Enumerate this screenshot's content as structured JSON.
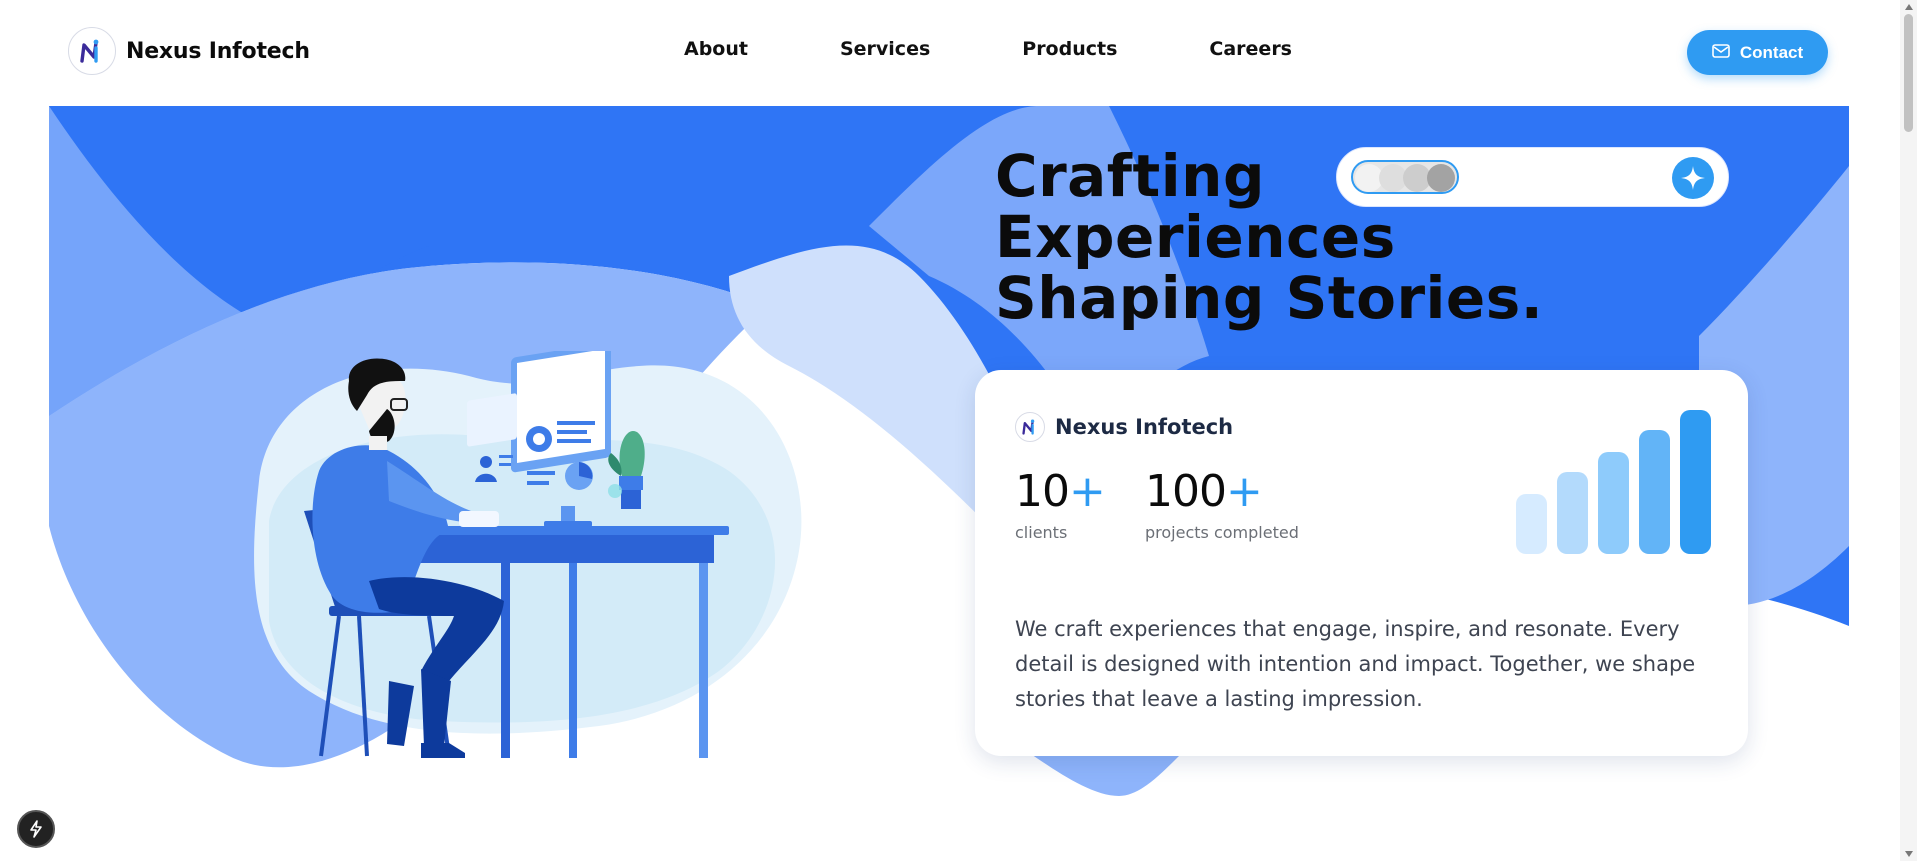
{
  "brand": {
    "name": "Nexus Infotech",
    "logo_icon": "nexus-logo-icon"
  },
  "nav": {
    "links": [
      {
        "label": "About"
      },
      {
        "label": "Services"
      },
      {
        "label": "Products"
      },
      {
        "label": "Careers"
      }
    ],
    "contact": {
      "label": "Contact",
      "icon": "mail-icon"
    }
  },
  "hero": {
    "headline": [
      "Crafting",
      "Experiences",
      "Shaping Stories."
    ],
    "search_pill": {
      "toggle_icon": "toggle-dots-icon",
      "action_icon": "sparkle-icon"
    },
    "illustration": "person-at-desk-illustration"
  },
  "card": {
    "brand_name": "Nexus Infotech",
    "stats": [
      {
        "number": "10",
        "suffix": "+",
        "label": "clients"
      },
      {
        "number": "100",
        "suffix": "+",
        "label": "projects completed"
      }
    ],
    "bar_levels": [
      0.42,
      0.57,
      0.71,
      0.86,
      1.0
    ],
    "bar_colors": [
      "#d6ebff",
      "#b3dafc",
      "#8ecbfb",
      "#62b4f7",
      "#2f9bf2"
    ],
    "description": "We craft experiences that engage, inspire, and resonate. Every detail is designed with intention and impact. Together, we shape stories that leave a lasting impression."
  },
  "floating_button": {
    "icon": "bolt-icon"
  },
  "colors": {
    "accent": "#2f9bf2",
    "hero_blue": "#2f75f5",
    "light_blue": "#8eb4fb",
    "pale_blue": "#cfe0fc"
  }
}
